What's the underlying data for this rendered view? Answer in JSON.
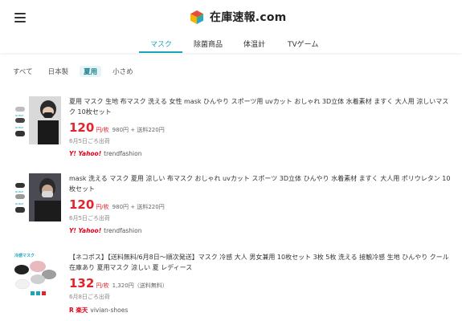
{
  "header": {
    "brand": "在庫速報.com",
    "tabs": [
      {
        "label": "マスク"
      },
      {
        "label": "除菌商品"
      },
      {
        "label": "体温計"
      },
      {
        "label": "TVゲーム"
      }
    ]
  },
  "filters": [
    "すべて",
    "日本製",
    "夏用",
    "小さめ"
  ],
  "items": [
    {
      "title": "夏用 マスク 生地 布マスク 洗える 女性 mask ひんやり スポーツ用 uvカット おしゃれ 3D立体 水着素材 ますく 大人用 涼しいマスク 10枚セット",
      "price": "120",
      "unit": "円/枚",
      "price_sub": "980円 + 送料220円",
      "ship": "6月5日ごろ出荷",
      "shop_logo": "Y! Yahoo!",
      "shop": "trendfashion"
    },
    {
      "title": "mask 洗える マスク 夏用 涼しい 布マスク おしゃれ uvカット スポーツ 3D立体 ひんやり 水着素材 ますく 大人用 ポリウレタン 10枚セット",
      "price": "120",
      "unit": "円/枚",
      "price_sub": "980円 + 送料220円",
      "ship": "6月5日ごろ出荷",
      "shop_logo": "Y! Yahoo!",
      "shop": "trendfashion"
    },
    {
      "title": "【ネコポス】【送料無料/6月8日〜順次発送】マスク 冷感 大人 男女兼用 10枚セット 3枚 5枚 洗える 接触冷感 生地 ひんやり クール 在庫あり 夏用マスク 涼しい 夏 レディース",
      "price": "132",
      "unit": "円/枚",
      "price_sub": "1,320円（送料無料）",
      "ship": "6月8日ごろ出荷",
      "shop_logo": "R 楽天",
      "shop": "vivian-shoes"
    }
  ],
  "colors": {
    "accent": "#1aa4b8",
    "price": "#e3232c"
  }
}
